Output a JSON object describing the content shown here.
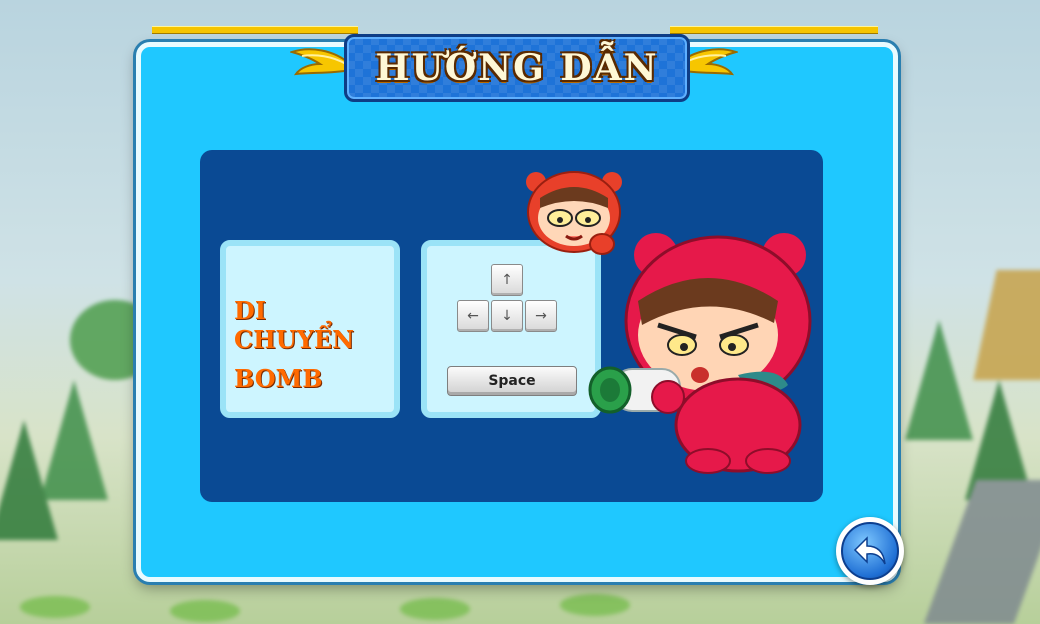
{
  "title": "HƯỚNG DẪN",
  "controls": {
    "move_label": "DI CHUYỂN",
    "bomb_label": "BOMB",
    "keys": {
      "up": "↑",
      "left": "←",
      "down": "↓",
      "right": "→",
      "space": "Space"
    }
  },
  "icons": {
    "back": "back-arrow-icon",
    "wings": "gold-wing-icon"
  },
  "colors": {
    "panel": "#1fc8ff",
    "inner": "#0a4a94",
    "label": "#ff6a00",
    "banner": "#1e73d8"
  }
}
